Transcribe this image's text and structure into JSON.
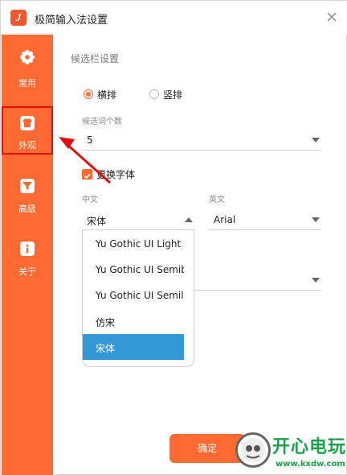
{
  "window": {
    "title": "极简输入法设置"
  },
  "sidebar": {
    "items": [
      {
        "label": "常用",
        "icon": "gear-icon"
      },
      {
        "label": "外观",
        "icon": "shirt-icon",
        "active": true
      },
      {
        "label": "高级",
        "icon": "filter-icon"
      },
      {
        "label": "关于",
        "icon": "info-icon"
      }
    ]
  },
  "candidate": {
    "section_title": "候选栏设置",
    "orientation": {
      "horizontal": "横排",
      "vertical": "竖排",
      "selected": "横排"
    },
    "count_label": "候选词个数",
    "count_value": "5"
  },
  "font": {
    "change_font_label": "更换字体",
    "change_font_checked": true,
    "chinese_label": "中文",
    "chinese_value": "宋体",
    "english_label": "英文",
    "english_value": "Arial",
    "dropdown_options": [
      "Yu Gothic UI Light",
      "Yu Gothic UI Semib",
      "Yu Gothic UI Semili",
      "仿宋",
      "宋体"
    ],
    "dropdown_selected": "宋体"
  },
  "footer": {
    "confirm_label": "确定"
  },
  "watermark": {
    "text": "开心电玩",
    "url": "www.kxdw.com"
  },
  "colors": {
    "accent": "#ff6a32",
    "selected": "#3399d6",
    "annotation": "#e01010",
    "watermark": "#1aa34a"
  }
}
